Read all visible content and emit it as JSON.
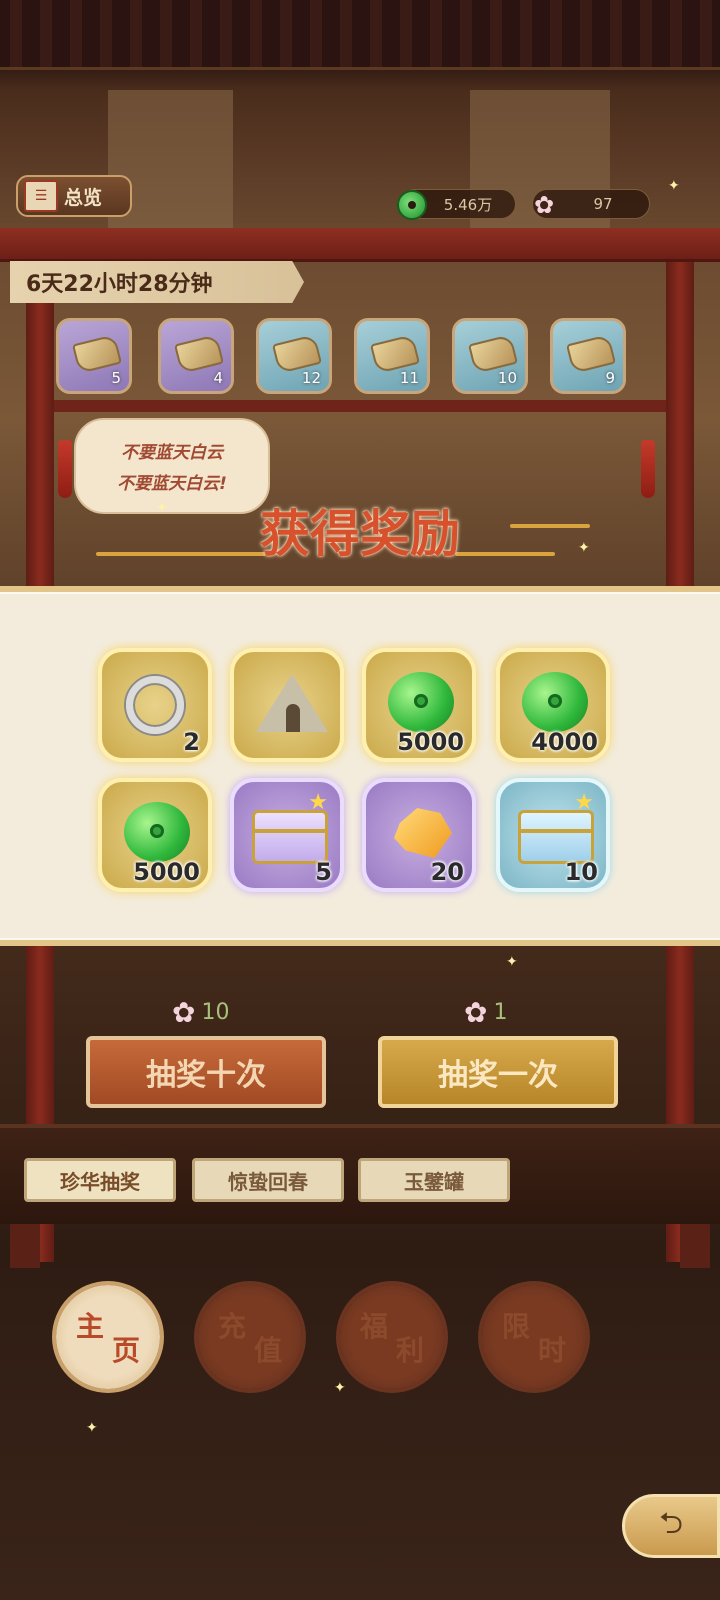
{
  "top_bar": {
    "overview_label": "总览",
    "overview_icon": "book-icon",
    "jade_amount": "5.46万",
    "petal_amount": "97"
  },
  "timer": "6天22小时28分钟",
  "shelf": {
    "items": [
      {
        "count": "5",
        "rarity": "purple"
      },
      {
        "count": "4",
        "rarity": "purple"
      },
      {
        "count": "12",
        "rarity": "blue"
      },
      {
        "count": "11",
        "rarity": "blue"
      },
      {
        "count": "10",
        "rarity": "blue"
      },
      {
        "count": "9",
        "rarity": "blue"
      }
    ]
  },
  "bubble": {
    "line1": "不要蓝天白云",
    "line2": "不要蓝天白云!"
  },
  "reward": {
    "title": "获得奖励",
    "items": [
      {
        "icon": "silver-ring-icon",
        "count": "2",
        "rarity": "gold"
      },
      {
        "icon": "tent-icon",
        "count": "",
        "rarity": "gold"
      },
      {
        "icon": "jade-coin-icon",
        "count": "5000",
        "rarity": "gold"
      },
      {
        "icon": "jade-coin-icon",
        "count": "4000",
        "rarity": "gold"
      },
      {
        "icon": "jade-coin-icon",
        "count": "5000",
        "rarity": "gold"
      },
      {
        "icon": "purple-chest-icon",
        "count": "5",
        "rarity": "purple"
      },
      {
        "icon": "gold-ore-icon",
        "count": "20",
        "rarity": "purple"
      },
      {
        "icon": "blue-chest-icon",
        "count": "10",
        "rarity": "blue"
      }
    ]
  },
  "draw": {
    "ten_cost": "10",
    "one_cost": "1",
    "ten_label": "抽奖十次",
    "one_label": "抽奖一次"
  },
  "banners": [
    "珍华抽奖",
    "惊蛰回春",
    "玉鐾罐"
  ],
  "nav": [
    {
      "c1": "主",
      "c2": "页",
      "active": true
    },
    {
      "c1": "充",
      "c2": "值",
      "active": false
    },
    {
      "c1": "福",
      "c2": "利",
      "active": false
    },
    {
      "c1": "限",
      "c2": "时",
      "active": false
    }
  ],
  "colors": {
    "accent_red": "#d6512c",
    "gold": "#e3c58a",
    "panel": "#f3ecdd"
  }
}
